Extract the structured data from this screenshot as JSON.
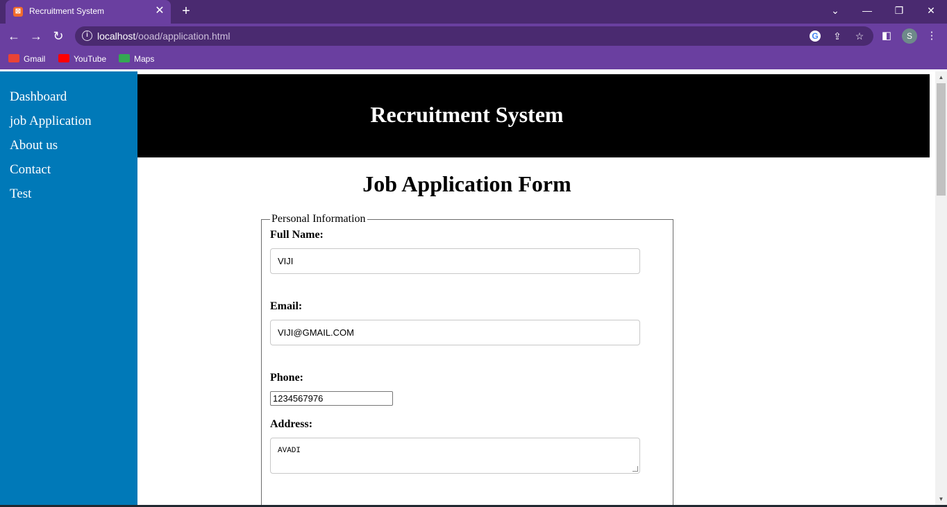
{
  "browser": {
    "tab_title": "Recruitment System",
    "tab_close": "✕",
    "new_tab": "+",
    "url_host": "localhost",
    "url_path": "/ooad/application.html",
    "avatar_letter": "S",
    "bookmarks": [
      {
        "label": "Gmail",
        "icon": "gmail-icon",
        "color": "#ea4335"
      },
      {
        "label": "YouTube",
        "icon": "youtube-icon",
        "color": "#ff0000"
      },
      {
        "label": "Maps",
        "icon": "maps-icon",
        "color": "#34a853"
      }
    ]
  },
  "sidebar": {
    "items": [
      {
        "label": "Dashboard"
      },
      {
        "label": "job Application"
      },
      {
        "label": "About us"
      },
      {
        "label": "Contact"
      },
      {
        "label": "Test"
      }
    ]
  },
  "header": {
    "title": "Recruitment System"
  },
  "form": {
    "title": "Job Application Form",
    "legend": "Personal Information",
    "full_name_label": "Full Name:",
    "full_name_value": "VIJI",
    "email_label": "Email:",
    "email_value": "VIJI@GMAIL.COM",
    "phone_label": "Phone:",
    "phone_value": "1234567976",
    "address_label": "Address:",
    "address_value": "AVADI"
  },
  "colors": {
    "sidebar": "#0079b8",
    "header": "#000000",
    "browser_frame": "#6a3fa0"
  }
}
